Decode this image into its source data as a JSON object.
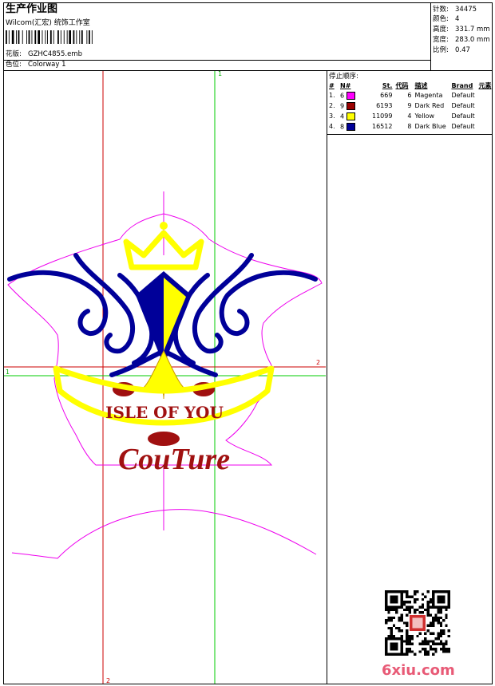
{
  "header": {
    "title": "生产作业图",
    "company": "Wilcom(汇宏) 统饰工作室",
    "design_label": "花版:",
    "design_value": "GZHC4855.emb",
    "colorway_label": "色位:",
    "colorway_value": "Colorway 1"
  },
  "stats": [
    {
      "label": "针数:",
      "value": "34475"
    },
    {
      "label": "颜色:",
      "value": "4"
    },
    {
      "label": "高度:",
      "value": "331.7 mm"
    },
    {
      "label": "宽度:",
      "value": "283.0 mm"
    },
    {
      "label": "比例:",
      "value": "0.47"
    }
  ],
  "sequence": {
    "title": "停止顺序:",
    "columns": [
      "#",
      "N#",
      "St.",
      "代码",
      "描述",
      "Brand",
      "元素"
    ],
    "rows": [
      {
        "idx": "1.",
        "n": "6",
        "color": "#ff00ff",
        "stitches": "669",
        "code": "6",
        "desc": "Magenta",
        "brand": "Default"
      },
      {
        "idx": "2.",
        "n": "9",
        "color": "#990000",
        "stitches": "6193",
        "code": "9",
        "desc": "Dark Red",
        "brand": "Default"
      },
      {
        "idx": "3.",
        "n": "4",
        "color": "#ffff00",
        "stitches": "11099",
        "code": "4",
        "desc": "Yellow",
        "brand": "Default"
      },
      {
        "idx": "4.",
        "n": "8",
        "color": "#000099",
        "stitches": "16512",
        "code": "8",
        "desc": "Dark Blue",
        "brand": "Default"
      }
    ]
  },
  "design": {
    "banner_text": "ISLE OF YOU",
    "script_text": "CouTure",
    "axis_labels": {
      "top": "1",
      "right": "2",
      "left": "1",
      "bottom": "2"
    },
    "colors": {
      "outline": "#ee00ee",
      "red": "#a01010",
      "yellow": "#ffff00",
      "blue": "#000099",
      "guide_red": "#cc0000",
      "guide_green": "#00cc00"
    }
  },
  "watermark": "6xiu.com"
}
